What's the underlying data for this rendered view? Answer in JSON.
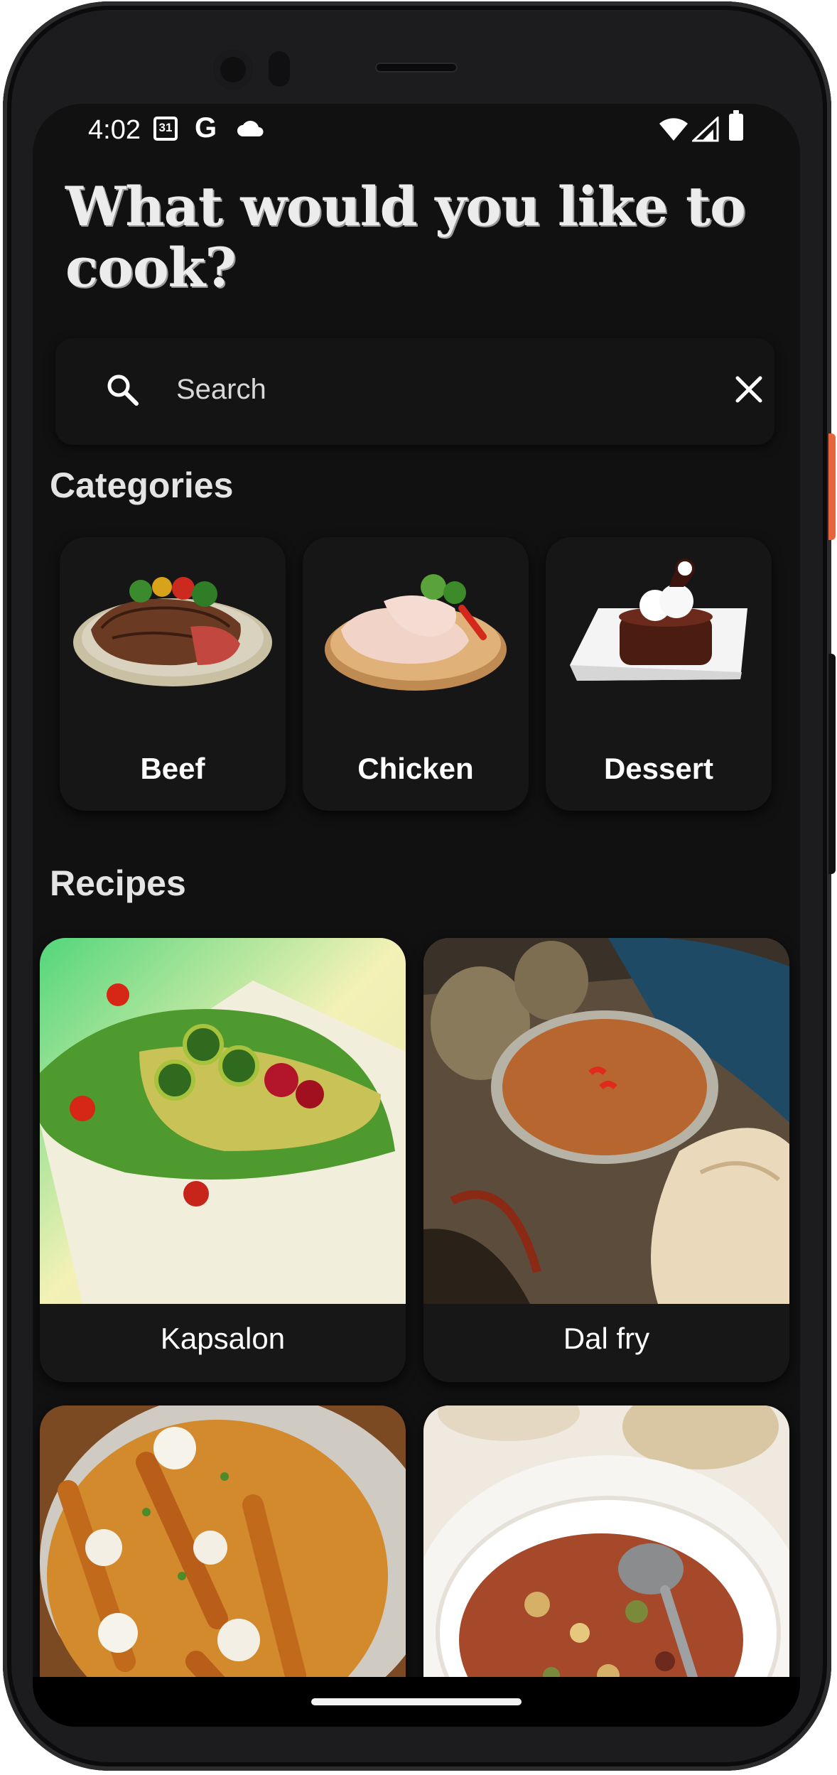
{
  "status_bar": {
    "time": "4:02",
    "calendar_day": "31",
    "g_glyph": "G"
  },
  "header": {
    "title": "What would you like to cook?"
  },
  "search": {
    "placeholder": "Search"
  },
  "categories": {
    "heading": "Categories",
    "items": [
      {
        "label": "Beef"
      },
      {
        "label": "Chicken"
      },
      {
        "label": "Dessert"
      }
    ]
  },
  "recipes": {
    "heading": "Recipes",
    "items": [
      {
        "label": "Kapsalon"
      },
      {
        "label": "Dal fry"
      },
      {
        "label": ""
      },
      {
        "label": ""
      }
    ]
  },
  "colors": {
    "background": "#111111",
    "card": "#171717",
    "text": "#ffffff",
    "accent_button": "#e8643c"
  }
}
